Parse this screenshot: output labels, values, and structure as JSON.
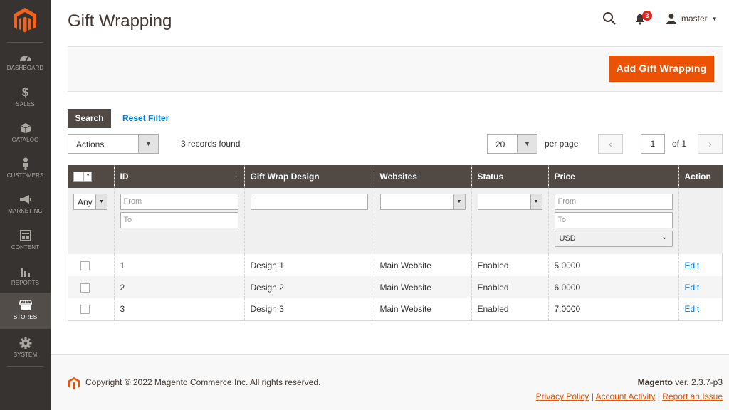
{
  "sidebar": {
    "items": [
      {
        "label": "DASHBOARD",
        "icon": "dashboard-icon"
      },
      {
        "label": "SALES",
        "icon": "dollar-icon"
      },
      {
        "label": "CATALOG",
        "icon": "box-icon"
      },
      {
        "label": "CUSTOMERS",
        "icon": "person-icon"
      },
      {
        "label": "MARKETING",
        "icon": "megaphone-icon"
      },
      {
        "label": "CONTENT",
        "icon": "layout-icon"
      },
      {
        "label": "REPORTS",
        "icon": "bar-chart-icon"
      },
      {
        "label": "STORES",
        "icon": "storefront-icon"
      },
      {
        "label": "SYSTEM",
        "icon": "gear-icon"
      }
    ]
  },
  "header": {
    "title": "Gift Wrapping",
    "notifications_count": "3",
    "user_name": "master"
  },
  "actions": {
    "add_button": "Add Gift Wrapping"
  },
  "grid_controls": {
    "search_button": "Search",
    "reset_filter": "Reset Filter",
    "mass_action": "Actions",
    "records_found": "3 records found",
    "per_page_value": "20",
    "per_page_label": "per page",
    "current_page": "1",
    "page_of": "of 1"
  },
  "table": {
    "columns": [
      "ID",
      "Gift Wrap Design",
      "Websites",
      "Status",
      "Price",
      "Action"
    ],
    "filters": {
      "any": "Any",
      "from_placeholder": "From",
      "to_placeholder": "To",
      "currency": "USD"
    },
    "rows": [
      {
        "id": "1",
        "design": "Design 1",
        "website": "Main Website",
        "status": "Enabled",
        "price": "5.0000",
        "action": "Edit"
      },
      {
        "id": "2",
        "design": "Design 2",
        "website": "Main Website",
        "status": "Enabled",
        "price": "6.0000",
        "action": "Edit"
      },
      {
        "id": "3",
        "design": "Design 3",
        "website": "Main Website",
        "status": "Enabled",
        "price": "7.0000",
        "action": "Edit"
      }
    ]
  },
  "footer": {
    "copyright": "Copyright © 2022 Magento Commerce Inc. All rights reserved.",
    "brand": "Magento",
    "version": "ver. 2.3.7-p3",
    "links": [
      "Privacy Policy",
      "Account Activity",
      "Report an Issue"
    ]
  },
  "colors": {
    "sidebar_bg": "#373330",
    "accent": "#eb5202",
    "header_row": "#514943",
    "link": "#007bdb"
  }
}
